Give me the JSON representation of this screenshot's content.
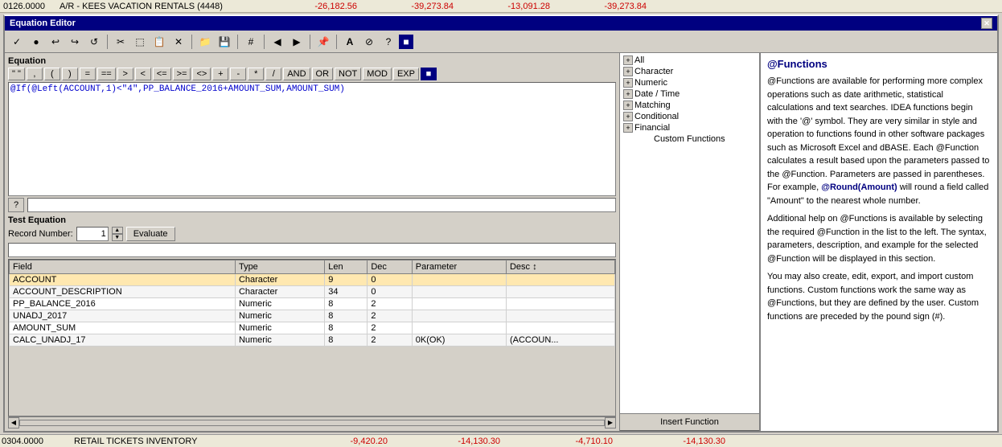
{
  "topRow": {
    "col1": "0126.0000",
    "col2": "A/R - KEES VACATION RENTALS (4448)",
    "col3": "-26,182.56",
    "col4": "-39,273.84",
    "col5": "-13,091.28",
    "col6": "-39,273.84"
  },
  "bottomRow": {
    "col1": "0304.0000",
    "col2": "RETAIL TICKETS INVENTORY",
    "col3": "-9,420.20",
    "col4": "-14,130.30",
    "col5": "-4,710.10",
    "col6": "-14,130.30"
  },
  "editorTitle": "Equation Editor",
  "closeBtn": "✕",
  "equation": {
    "label": "Equation",
    "operators": [
      "\" \"",
      ",",
      "(",
      ")",
      "=",
      "==",
      ">",
      "<",
      "<=",
      ">=",
      "<>",
      "+",
      "-",
      "*",
      "/",
      "AND",
      "OR",
      "NOT",
      "MOD",
      "EXP"
    ],
    "formula": "@If(@Left(ACCOUNT,1)<\"4\",PP_BALANCE_2016+AMOUNT_SUM,AMOUNT_SUM)",
    "hintBtnLabel": "?",
    "hintInput": ""
  },
  "testSection": {
    "label": "Test Equation",
    "recordLabel": "Record Number:",
    "recordValue": "1",
    "evaluateBtn": "Evaluate",
    "resultValue": ""
  },
  "table": {
    "headers": [
      "Field",
      "Type",
      "Len",
      "Dec",
      "Parameter",
      "Desc"
    ],
    "rows": [
      {
        "field": "ACCOUNT",
        "type": "Character",
        "len": "9",
        "dec": "0",
        "parameter": "",
        "desc": "",
        "highlight": true
      },
      {
        "field": "ACCOUNT_DESCRIPTION",
        "type": "Character",
        "len": "34",
        "dec": "0",
        "parameter": "",
        "desc": ""
      },
      {
        "field": "PP_BALANCE_2016",
        "type": "Numeric",
        "len": "8",
        "dec": "2",
        "parameter": "",
        "desc": ""
      },
      {
        "field": "UNADJ_2017",
        "type": "Numeric",
        "len": "8",
        "dec": "2",
        "parameter": "",
        "desc": ""
      },
      {
        "field": "AMOUNT_SUM",
        "type": "Numeric",
        "len": "8",
        "dec": "2",
        "parameter": "",
        "desc": ""
      },
      {
        "field": "CALC_UNADJ_17",
        "type": "Numeric",
        "len": "8",
        "dec": "2",
        "parameter": "0K(OK)",
        "desc": "(ACCOUN..."
      }
    ]
  },
  "treeView": {
    "items": [
      {
        "label": "All",
        "expanded": true,
        "icon": "+"
      },
      {
        "label": "Character",
        "expanded": false,
        "icon": "+"
      },
      {
        "label": "Numeric",
        "expanded": false,
        "icon": "+"
      },
      {
        "label": "Date / Time",
        "expanded": false,
        "icon": "+"
      },
      {
        "label": "Matching",
        "expanded": false,
        "icon": "+"
      },
      {
        "label": "Conditional",
        "expanded": false,
        "icon": "+"
      },
      {
        "label": "Financial",
        "expanded": false,
        "icon": "+"
      },
      {
        "label": "Custom Functions",
        "expanded": false,
        "icon": ""
      }
    ]
  },
  "insertFunctionBtn": "Insert Function",
  "rightPanel": {
    "title": "@Functions",
    "paragraphs": [
      "@Functions are available for performing more complex operations such as date arithmetic, statistical calculations and text searches. IDEA functions begin with the '@' symbol. They are very similar in style and operation to functions found in other software packages such as Microsoft Excel and dBASE. Each @Function calculates a result based upon the parameters passed to the @Function. Parameters are passed in parentheses. For example, @Round(Amount) will round a field called \"Amount\" to the nearest whole number.",
      "Additional help on @Functions is available by selecting the required @Function in the list to the left. The syntax, parameters, description, and example for the selected @Function will be displayed in this section.",
      "You may also create, edit, export, and import custom functions. Custom functions work the same way as @Functions, but they are defined by the user. Custom functions are preceded by the pound sign (#)."
    ],
    "highlightText": "@Round(Amount)"
  },
  "toolbar": {
    "buttons": [
      "✓",
      "●",
      "↩",
      "↪",
      "↺",
      "✂",
      "⬚",
      "⬛",
      "✕",
      "📁",
      "💾",
      "#",
      "◀",
      "▶",
      "📌",
      "A",
      "⊘",
      "?"
    ]
  }
}
